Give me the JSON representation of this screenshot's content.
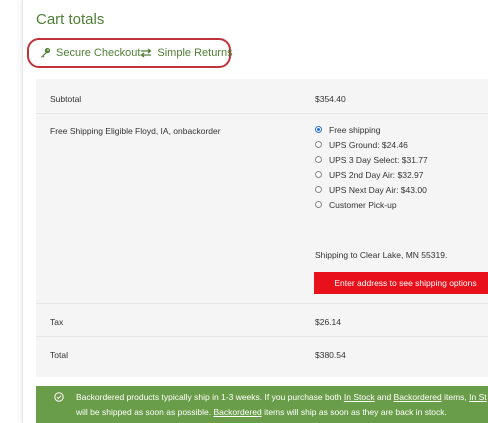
{
  "cart": {
    "title": "Cart totals",
    "features": [
      {
        "icon": "key-icon",
        "label": "Secure Checkout"
      },
      {
        "icon": "swap-arrows-icon",
        "label": "Simple Returns"
      }
    ]
  },
  "totals": {
    "subtotal_label": "Subtotal",
    "subtotal_value": "$354.40",
    "shipping_label": "Free Shipping Eligible Floyd, IA, onbackorder",
    "shipping_options": [
      {
        "label": "Free shipping",
        "selected": true
      },
      {
        "label": "UPS Ground: $24.46",
        "selected": false
      },
      {
        "label": "UPS 3 Day Select: $31.77",
        "selected": false
      },
      {
        "label": "UPS 2nd Day Air: $32.97",
        "selected": false
      },
      {
        "label": "UPS Next Day Air: $43.00",
        "selected": false
      },
      {
        "label": "Customer Pick-up",
        "selected": false
      }
    ],
    "shipping_to": "Shipping to Clear Lake, MN 55319.",
    "address_button": "Enter address to see shipping options",
    "tax_label": "Tax",
    "tax_value": "$26.14",
    "total_label": "Total",
    "total_value": "$380.54"
  },
  "notice": {
    "line1_a": "Backordered products typically ship in 1-3 weeks. If you purchase both ",
    "line1_b": "In Stock",
    "line1_c": " and ",
    "line1_d": "Backordered",
    "line1_e": " items, ",
    "line1_f": "In St",
    "line2_a": "will be shipped as soon as possible. ",
    "line2_b": "Backordered",
    "line2_c": " items will ship as soon as they are back in stock."
  },
  "colors": {
    "accent_green": "#4f7f35",
    "notice_green": "#6a9d49",
    "button_red": "#e8101a",
    "highlight_circle": "#c0333b",
    "radio_blue": "#2a73d8"
  }
}
